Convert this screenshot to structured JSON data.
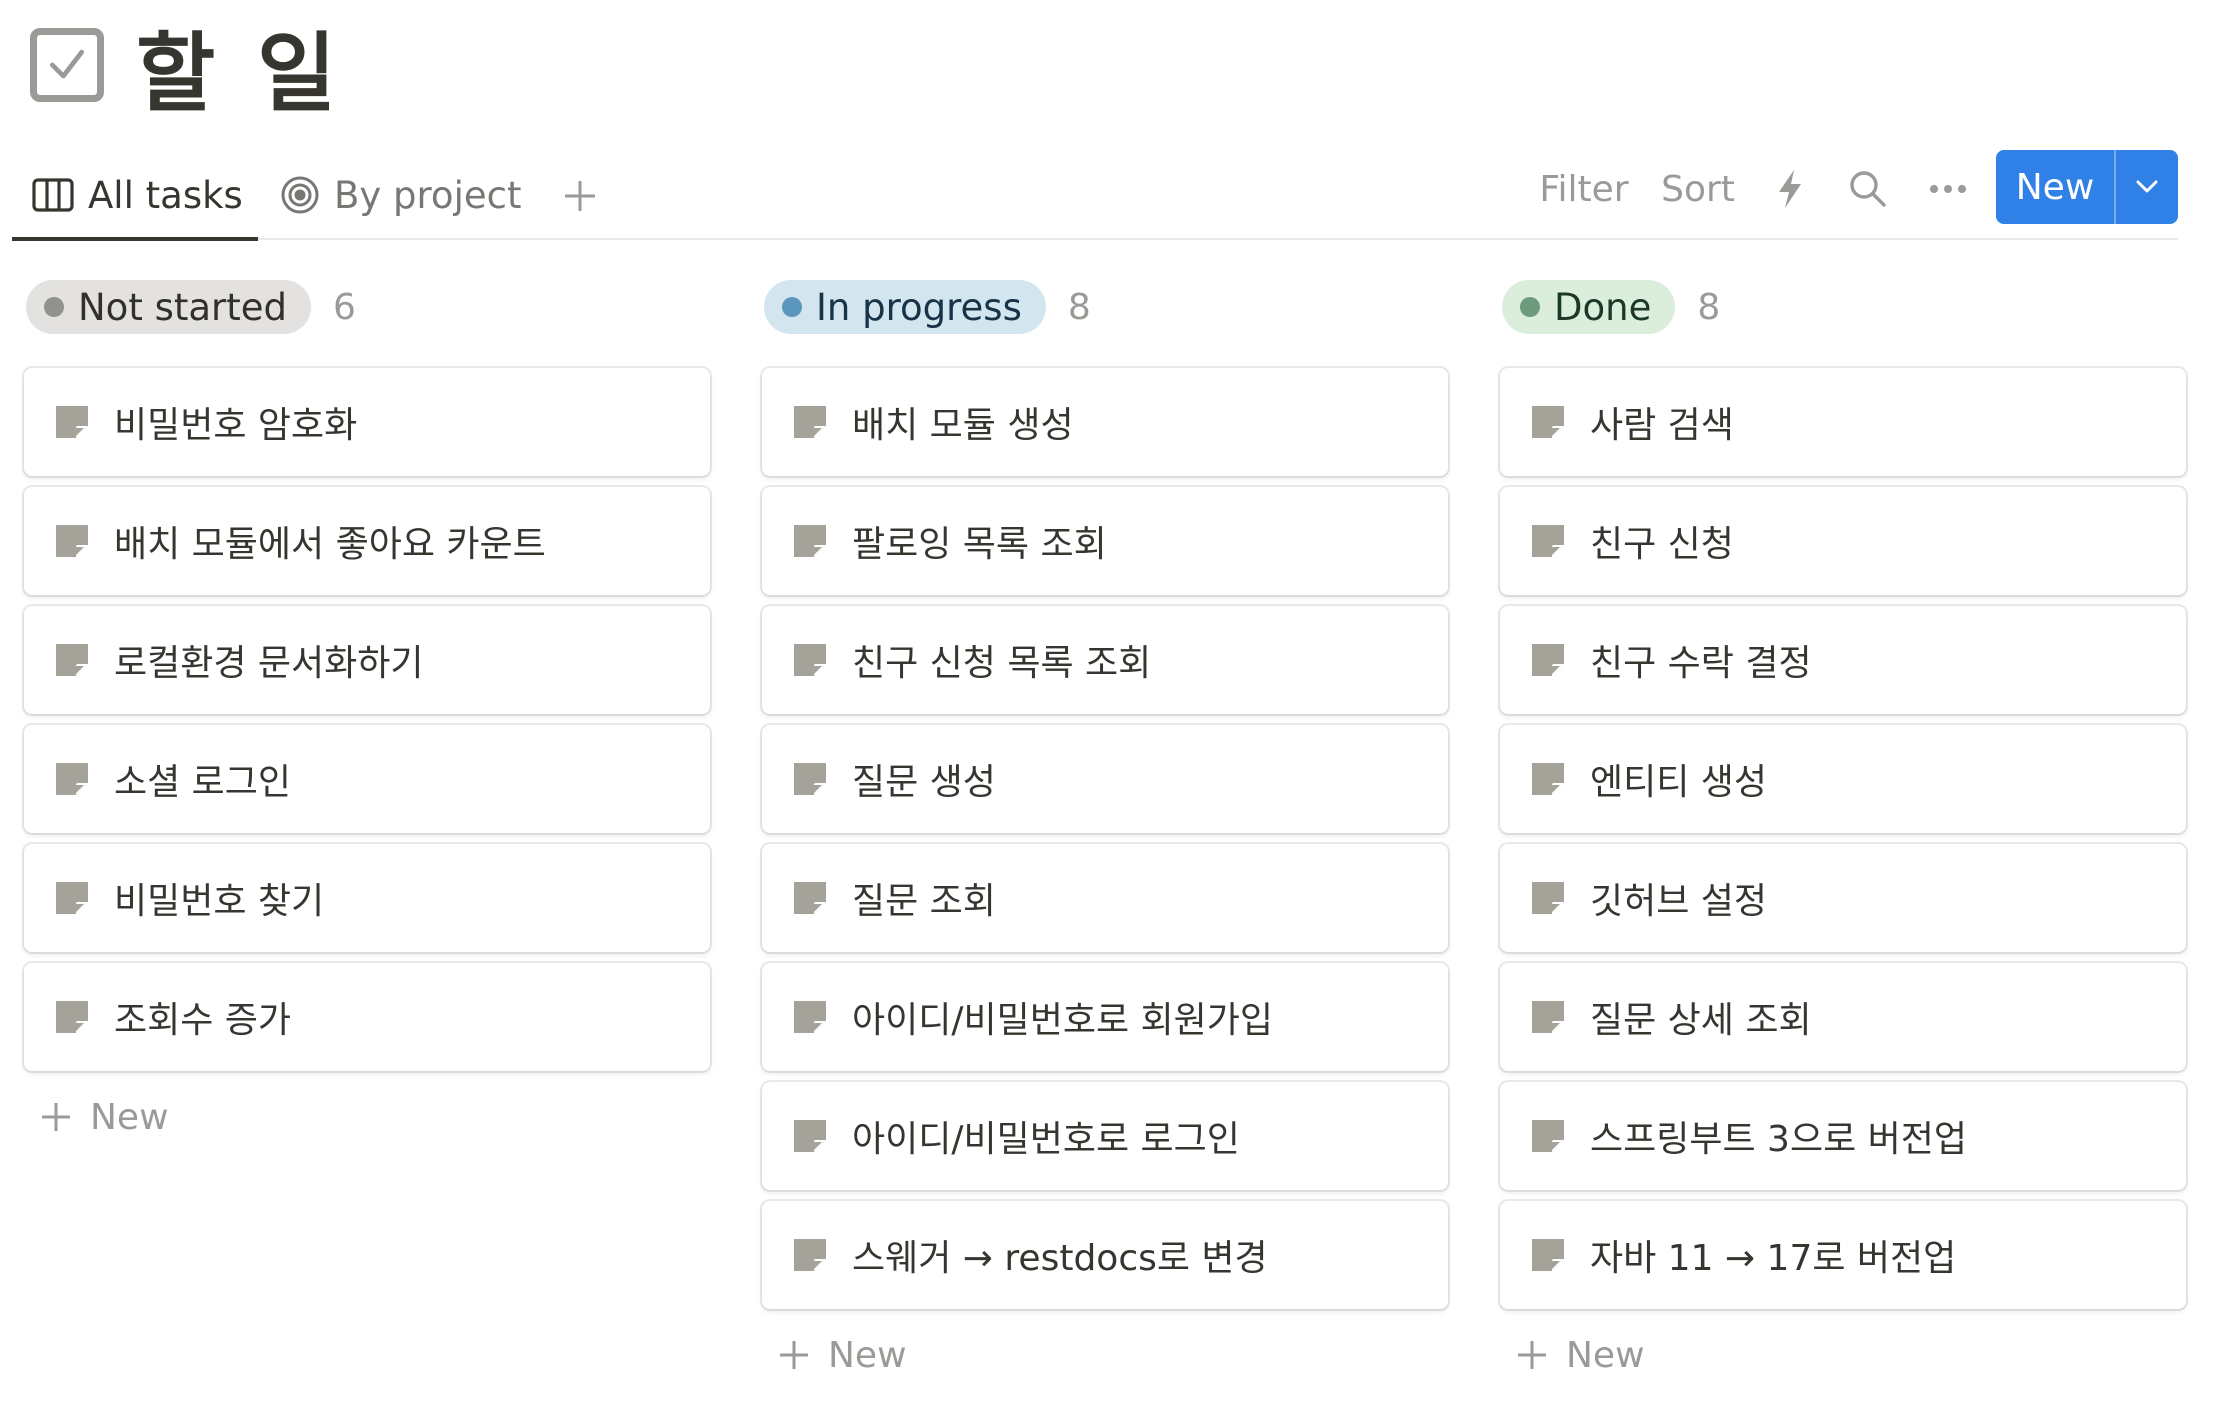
{
  "page": {
    "title": "할 일",
    "icon": "checkbox-icon"
  },
  "views": [
    {
      "label": "All tasks",
      "icon": "board-icon",
      "active": true
    },
    {
      "label": "By project",
      "icon": "target-icon",
      "active": false
    }
  ],
  "toolbar": {
    "filter_label": "Filter",
    "sort_label": "Sort",
    "automation_icon": "lightning-icon",
    "search_icon": "search-icon",
    "more_icon": "more-icon",
    "new_label": "New",
    "accent_color": "#2f80e7"
  },
  "columns": [
    {
      "status": "Not started",
      "count": "6",
      "pill_color": "#e3e2e0",
      "dot_color": "#91918e",
      "text_color": "#32302c",
      "cards": [
        "비밀번호 암호화",
        "배치 모듈에서 좋아요 카운트",
        "로컬환경 문서화하기",
        "소셜 로그인",
        "비밀번호 찾기",
        "조회수 증가"
      ],
      "add_label": "New"
    },
    {
      "status": "In progress",
      "count": "8",
      "pill_color": "#d3e5ef",
      "dot_color": "#5b97bd",
      "text_color": "#183347",
      "cards": [
        "배치 모듈 생성",
        "팔로잉 목록 조회",
        "친구 신청 목록 조회",
        "질문 생성",
        "질문 조회",
        "아이디/비밀번호로 회원가입",
        "아이디/비밀번호로 로그인",
        "스웨거 → restdocs로 변경"
      ],
      "add_label": "New"
    },
    {
      "status": "Done",
      "count": "8",
      "pill_color": "#dbeddb",
      "dot_color": "#6c9b7d",
      "text_color": "#1c3829",
      "cards": [
        "사람 검색",
        "친구 신청",
        "친구 수락 결정",
        "엔티티 생성",
        "깃허브 설정",
        "질문 상세 조회",
        "스프링부트 3으로 버전업",
        "자바 11 → 17로 버전업"
      ],
      "add_label": "New"
    }
  ]
}
